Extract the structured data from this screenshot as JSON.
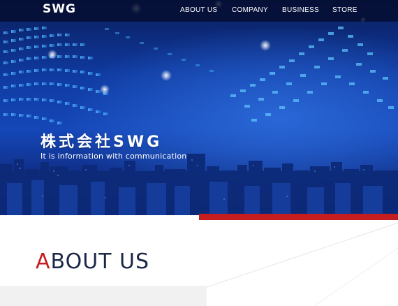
{
  "header": {
    "logo": "SWG",
    "nav": [
      {
        "label": "ABOUT US"
      },
      {
        "label": "COMPANY"
      },
      {
        "label": "BUSINESS"
      },
      {
        "label": "STORE"
      }
    ]
  },
  "hero": {
    "title": "株式会社SWG",
    "subtitle": "It is information with communication"
  },
  "about": {
    "heading_first": "A",
    "heading_rest": "BOUT US"
  },
  "colors": {
    "accent_red": "#c41d20",
    "hero_blue": "#1547b8",
    "heading_navy": "#1b2747",
    "topbar": "#050e30"
  }
}
